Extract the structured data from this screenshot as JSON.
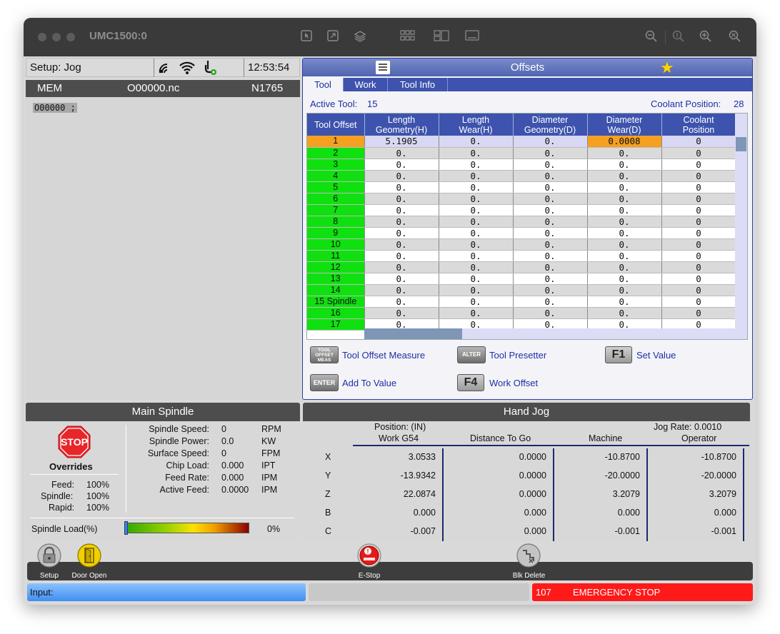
{
  "window": {
    "title": "UMC1500:0"
  },
  "status": {
    "mode": "Setup: Jog",
    "clock": "12:53:54"
  },
  "program": {
    "mode": "MEM",
    "file": "O00000.nc",
    "line": "N1765",
    "code": "O00000 ;"
  },
  "offsets": {
    "title": "Offsets",
    "tabs": [
      "Tool",
      "Work",
      "Tool Info"
    ],
    "active_tool_label": "Active Tool:",
    "active_tool": "15",
    "coolant_label": "Coolant Position:",
    "coolant_value": "28",
    "columns": [
      [
        "Tool Offset",
        ""
      ],
      [
        "Length",
        "Geometry(H)"
      ],
      [
        "Length",
        "Wear(H)"
      ],
      [
        "Diameter",
        "Geometry(D)"
      ],
      [
        "Diameter",
        "Wear(D)"
      ],
      [
        "Coolant",
        "Position"
      ]
    ],
    "rows": [
      [
        "1",
        "5.1905",
        "0.",
        "0.",
        "0.0008",
        "0"
      ],
      [
        "2",
        "0.",
        "0.",
        "0.",
        "0.",
        "0"
      ],
      [
        "3",
        "0.",
        "0.",
        "0.",
        "0.",
        "0"
      ],
      [
        "4",
        "0.",
        "0.",
        "0.",
        "0.",
        "0"
      ],
      [
        "5",
        "0.",
        "0.",
        "0.",
        "0.",
        "0"
      ],
      [
        "6",
        "0.",
        "0.",
        "0.",
        "0.",
        "0"
      ],
      [
        "7",
        "0.",
        "0.",
        "0.",
        "0.",
        "0"
      ],
      [
        "8",
        "0.",
        "0.",
        "0.",
        "0.",
        "0"
      ],
      [
        "9",
        "0.",
        "0.",
        "0.",
        "0.",
        "0"
      ],
      [
        "10",
        "0.",
        "0.",
        "0.",
        "0.",
        "0"
      ],
      [
        "11",
        "0.",
        "0.",
        "0.",
        "0.",
        "0"
      ],
      [
        "12",
        "0.",
        "0.",
        "0.",
        "0.",
        "0"
      ],
      [
        "13",
        "0.",
        "0.",
        "0.",
        "0.",
        "0"
      ],
      [
        "14",
        "0.",
        "0.",
        "0.",
        "0.",
        "0"
      ],
      [
        "15 Spindle",
        "0.",
        "0.",
        "0.",
        "0.",
        "0"
      ],
      [
        "16",
        "0.",
        "0.",
        "0.",
        "0.",
        "0"
      ],
      [
        "17",
        "0.",
        "0.",
        "0.",
        "0.",
        "0"
      ]
    ],
    "keys": {
      "tool_offset_measure": {
        "key_lines": [
          "TOOL",
          "OFFSET",
          "MEAS"
        ],
        "label": "Tool Offset Measure"
      },
      "tool_presetter": {
        "key": "ALTER",
        "label": "Tool Presetter"
      },
      "set_value": {
        "key": "F1",
        "label": "Set Value"
      },
      "add_to_value": {
        "key": "ENTER",
        "label": "Add To Value"
      },
      "work_offset": {
        "key": "F4",
        "label": "Work Offset"
      }
    }
  },
  "spindle": {
    "title": "Main Spindle",
    "stop_text": "STOP",
    "overrides_label": "Overrides",
    "overrides": [
      {
        "label": "Feed:",
        "value": "100%"
      },
      {
        "label": "Spindle:",
        "value": "100%"
      },
      {
        "label": "Rapid:",
        "value": "100%"
      }
    ],
    "readouts": [
      {
        "label": "Spindle Speed:",
        "value": "0",
        "unit": "RPM"
      },
      {
        "label": "Spindle Power:",
        "value": "0.0",
        "unit": "KW"
      },
      {
        "label": "Surface Speed:",
        "value": "0",
        "unit": "FPM"
      },
      {
        "label": "Chip Load:",
        "value": "0.000",
        "unit": "IPT"
      },
      {
        "label": "Feed Rate:",
        "value": "0.000",
        "unit": "IPM"
      },
      {
        "label": "Active Feed:",
        "value": "0.0000",
        "unit": "IPM"
      }
    ],
    "load_label": "Spindle Load(%)",
    "load_value": "0%",
    "load_fraction": 0
  },
  "handjog": {
    "title": "Hand Jog",
    "position_label": "Position: (IN)",
    "jog_rate": "Jog Rate: 0.0010",
    "columns": [
      "Work G54",
      "Distance To Go",
      "Machine",
      "Operator"
    ],
    "axes": [
      {
        "axis": "X",
        "values": [
          "3.0533",
          "0.0000",
          "-10.8700",
          "-10.8700"
        ]
      },
      {
        "axis": "Y",
        "values": [
          "-13.9342",
          "0.0000",
          "-20.0000",
          "-20.0000"
        ]
      },
      {
        "axis": "Z",
        "values": [
          "22.0874",
          "0.0000",
          "3.2079",
          "3.2079"
        ]
      },
      {
        "axis": "B",
        "values": [
          "0.000",
          "0.000",
          "0.000",
          "0.000"
        ]
      },
      {
        "axis": "C",
        "values": [
          "-0.007",
          "0.000",
          "-0.001",
          "-0.001"
        ]
      }
    ]
  },
  "buttons": {
    "setup": "Setup",
    "door_open": "Door Open",
    "estop": "E-Stop",
    "blk_delete": "Blk Delete"
  },
  "bottom": {
    "input_label": "Input:",
    "alarm_code": "107",
    "alarm_text": "EMERGENCY STOP"
  },
  "colors": {
    "accent_blue": "#3d53ad",
    "tool_green": "#10e010",
    "selected_orange": "#f5a020",
    "alarm_red": "#ff1a1a"
  }
}
